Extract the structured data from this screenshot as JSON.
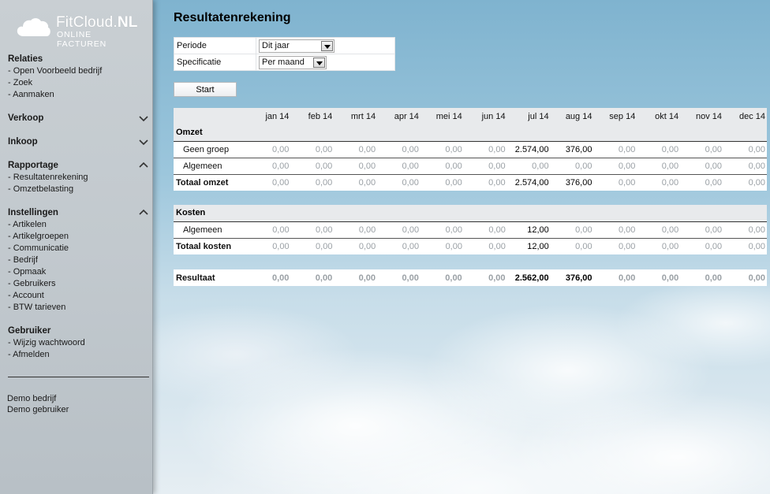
{
  "brand": {
    "name_light": "FitCloud.",
    "name_bold": "NL",
    "tagline": "ONLINE FACTUREN"
  },
  "sidebar": {
    "relaties": {
      "title": "Relaties",
      "items": [
        "- Open Voorbeeld bedrijf",
        "- Zoek",
        "- Aanmaken"
      ]
    },
    "verkoop": {
      "title": "Verkoop"
    },
    "inkoop": {
      "title": "Inkoop"
    },
    "rapportage": {
      "title": "Rapportage",
      "items": [
        "- Resultatenrekening",
        "- Omzetbelasting"
      ]
    },
    "instellingen": {
      "title": "Instellingen",
      "items": [
        "- Artikelen",
        "- Artikelgroepen",
        "- Communicatie",
        "- Bedrijf",
        "- Opmaak",
        "- Gebruikers",
        "- Account",
        "- BTW tarieven"
      ]
    },
    "gebruiker": {
      "title": "Gebruiker",
      "items": [
        "- Wijzig wachtwoord",
        "- Afmelden"
      ]
    },
    "footer": [
      "Demo bedrijf",
      "Demo gebruiker"
    ]
  },
  "page": {
    "title": "Resultatenrekening",
    "filters": {
      "periode_label": "Periode",
      "periode_value": "Dit jaar",
      "spec_label": "Specificatie",
      "spec_value": "Per maand"
    },
    "start_label": "Start"
  },
  "report": {
    "months": [
      "jan 14",
      "feb 14",
      "mrt 14",
      "apr 14",
      "mei 14",
      "jun 14",
      "jul 14",
      "aug 14",
      "sep 14",
      "okt 14",
      "nov 14",
      "dec 14"
    ],
    "omzet": {
      "title": "Omzet",
      "rows": [
        {
          "label": "Geen groep",
          "values": [
            "0,00",
            "0,00",
            "0,00",
            "0,00",
            "0,00",
            "0,00",
            "2.574,00",
            "376,00",
            "0,00",
            "0,00",
            "0,00",
            "0,00"
          ]
        },
        {
          "label": "Algemeen",
          "values": [
            "0,00",
            "0,00",
            "0,00",
            "0,00",
            "0,00",
            "0,00",
            "0,00",
            "0,00",
            "0,00",
            "0,00",
            "0,00",
            "0,00"
          ]
        }
      ],
      "total": {
        "label": "Totaal omzet",
        "values": [
          "0,00",
          "0,00",
          "0,00",
          "0,00",
          "0,00",
          "0,00",
          "2.574,00",
          "376,00",
          "0,00",
          "0,00",
          "0,00",
          "0,00"
        ]
      }
    },
    "kosten": {
      "title": "Kosten",
      "rows": [
        {
          "label": "Algemeen",
          "values": [
            "0,00",
            "0,00",
            "0,00",
            "0,00",
            "0,00",
            "0,00",
            "12,00",
            "0,00",
            "0,00",
            "0,00",
            "0,00",
            "0,00"
          ]
        }
      ],
      "total": {
        "label": "Totaal kosten",
        "values": [
          "0,00",
          "0,00",
          "0,00",
          "0,00",
          "0,00",
          "0,00",
          "12,00",
          "0,00",
          "0,00",
          "0,00",
          "0,00",
          "0,00"
        ]
      }
    },
    "resultaat": {
      "label": "Resultaat",
      "values": [
        "0,00",
        "0,00",
        "0,00",
        "0,00",
        "0,00",
        "0,00",
        "2.562,00",
        "376,00",
        "0,00",
        "0,00",
        "0,00",
        "0,00"
      ]
    }
  }
}
